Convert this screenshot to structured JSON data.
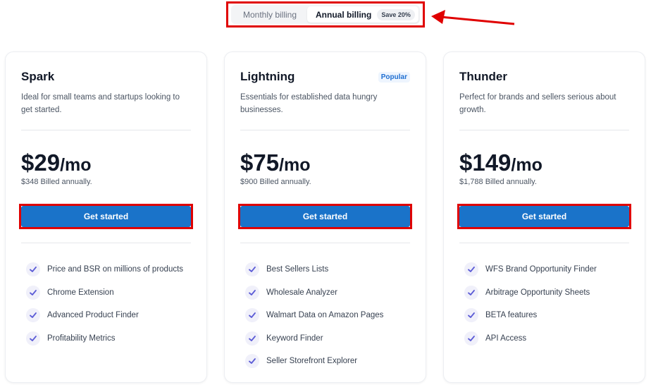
{
  "billing_toggle": {
    "monthly_label": "Monthly billing",
    "annual_label": "Annual billing",
    "save_badge": "Save 20%",
    "selected": "annual"
  },
  "colors": {
    "button": "#1a73c9",
    "annotation_red": "#e00000",
    "check": "#5b5bd6",
    "popular": "#1f6fd1"
  },
  "plans": [
    {
      "name": "Spark",
      "badge": "",
      "description": "Ideal for small teams and startups looking to get started.",
      "price": "$29",
      "period": "/mo",
      "billed": "$348 Billed annually.",
      "cta": "Get started",
      "features": [
        "Price and BSR on millions of products",
        "Chrome Extension",
        "Advanced Product Finder",
        "Profitability Metrics"
      ]
    },
    {
      "name": "Lightning",
      "badge": "Popular",
      "description": "Essentials for established data hungry businesses.",
      "price": "$75",
      "period": "/mo",
      "billed": "$900 Billed annually.",
      "cta": "Get started",
      "features": [
        "Best Sellers Lists",
        "Wholesale Analyzer",
        "Walmart Data on Amazon Pages",
        "Keyword Finder",
        "Seller Storefront Explorer"
      ]
    },
    {
      "name": "Thunder",
      "badge": "",
      "description": "Perfect for brands and sellers serious about growth.",
      "price": "$149",
      "period": "/mo",
      "billed": "$1,788 Billed annually.",
      "cta": "Get started",
      "features": [
        "WFS Brand Opportunity Finder",
        "Arbitrage Opportunity Sheets",
        "BETA features",
        "API Access"
      ]
    }
  ]
}
